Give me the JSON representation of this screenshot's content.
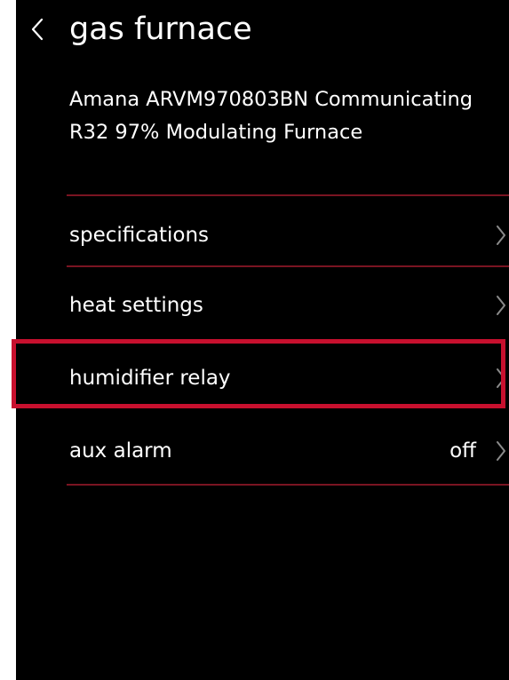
{
  "header": {
    "title": "gas furnace",
    "back_icon": "chevron-left-icon"
  },
  "device": {
    "name": "Amana ARVM970803BN Communicating R32 97% Modulating Furnace"
  },
  "menu": {
    "items": [
      {
        "label": "specifications",
        "value": "",
        "icon": "chevron-right-icon"
      },
      {
        "label": "heat settings",
        "value": "",
        "icon": "chevron-right-icon"
      },
      {
        "label": "humidifier relay",
        "value": "",
        "icon": "chevron-right-icon",
        "highlighted": true
      },
      {
        "label": "aux alarm",
        "value": "off",
        "icon": "chevron-right-icon"
      }
    ]
  },
  "colors": {
    "background": "#000000",
    "text": "#ffffff",
    "divider": "#7a1422",
    "highlight": "#c8102e"
  }
}
